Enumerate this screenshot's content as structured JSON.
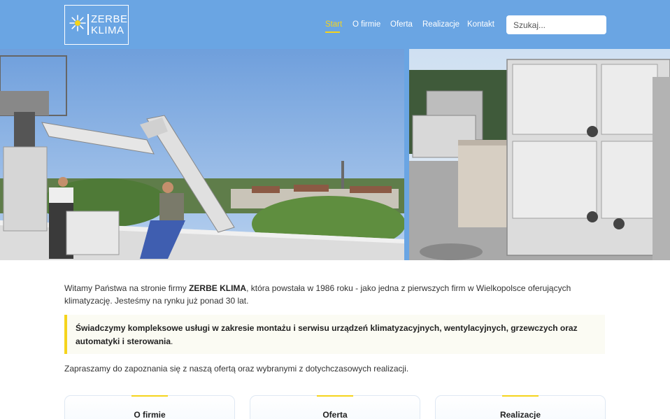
{
  "brand": {
    "line1": "ZERBE",
    "line2": "KLIMA",
    "colors": {
      "primary": "#6aa5e3",
      "accent": "#f5d41c"
    }
  },
  "nav": [
    {
      "label": "Start",
      "active": true
    },
    {
      "label": "O firmie",
      "active": false
    },
    {
      "label": "Oferta",
      "active": false
    },
    {
      "label": "Realizacje",
      "active": false
    },
    {
      "label": "Kontakt",
      "active": false
    }
  ],
  "search": {
    "placeholder": "Szukaj..."
  },
  "content": {
    "intro_before": "Witamy Państwa na stronie firmy ",
    "intro_brand": "ZERBE KLIMA",
    "intro_after": ", która powstała w 1986 roku - jako jedna z pierwszych firm w Wielkopolsce oferujących klimatyzację. Jesteśmy na rynku już ponad 30 lat.",
    "callout_bold": "Świadczymy kompleksowe usługi w zakresie montażu i serwisu urządzeń klimatyzacyjnych, wentylacyjnych, grzewczych oraz automatyki i sterowania",
    "callout_end": ".",
    "invite": "Zapraszamy do zapoznania się z naszą ofertą oraz wybranymi z dotychczasowych realizacji."
  },
  "cards": [
    {
      "label": "O firmie"
    },
    {
      "label": "Oferta"
    },
    {
      "label": "Realizacje"
    }
  ]
}
